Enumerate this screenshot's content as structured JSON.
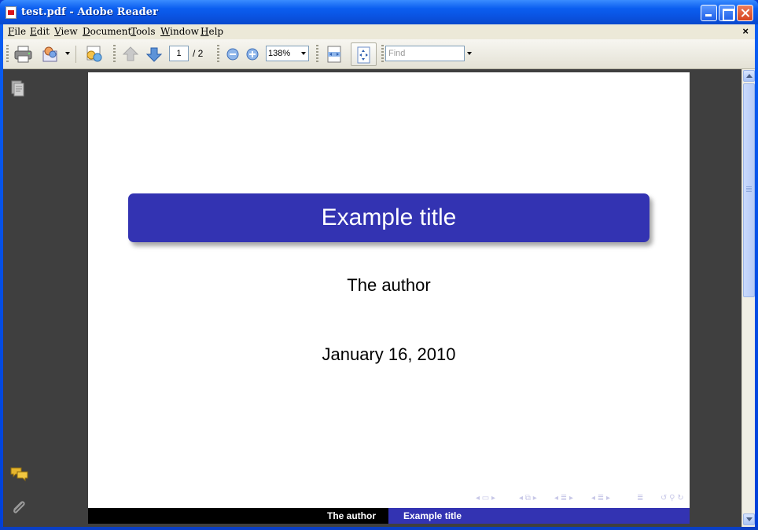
{
  "window": {
    "title": "test.pdf - Adobe Reader"
  },
  "menu": {
    "items": [
      "File",
      "Edit",
      "View",
      "Document",
      "Tools",
      "Window",
      "Help"
    ],
    "close": "×"
  },
  "toolbar": {
    "page_current": "1",
    "page_total": "/ 2",
    "zoom": "138%",
    "find_placeholder": "Find"
  },
  "icons": {
    "print": "printer-icon",
    "email": "email-icon",
    "collab": "collaborate-icon",
    "prev": "arrow-up-icon",
    "next": "arrow-down-icon",
    "zoom_out": "zoom-out-icon",
    "zoom_in": "zoom-in-icon",
    "fit_width": "fit-width-icon",
    "fit_page": "fit-page-icon",
    "pages": "pages-panel-icon",
    "comments": "comments-icon",
    "attachments": "paperclip-icon"
  },
  "slide": {
    "title": "Example title",
    "author": "The author",
    "date": "January 16, 2010",
    "footer_author": "The author",
    "footer_title": "Example title"
  },
  "colors": {
    "beamer_blue": "#3333b2",
    "footer_black": "#000000",
    "viewer_bg": "#3f3f3f"
  }
}
